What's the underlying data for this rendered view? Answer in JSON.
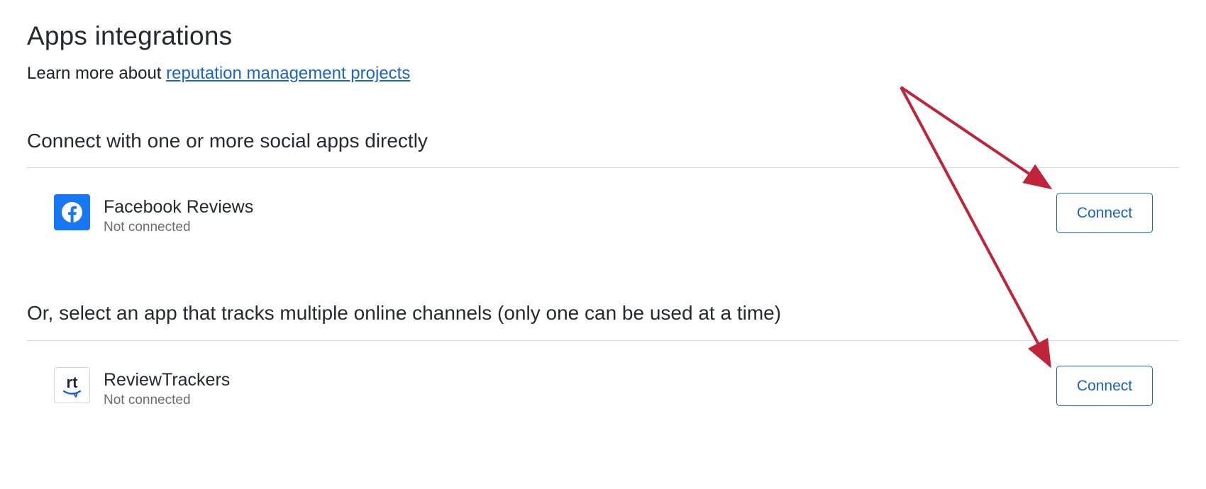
{
  "page": {
    "title": "Apps integrations",
    "intro_text": "Learn more about ",
    "intro_link": "reputation management projects"
  },
  "sections": [
    {
      "heading": "Connect with one or more social apps directly",
      "apps": [
        {
          "name": "Facebook Reviews",
          "status": "Not connected",
          "icon": "facebook-icon",
          "icon_color": "#1877f2",
          "button_label": "Connect"
        }
      ]
    },
    {
      "heading": "Or, select an app that tracks multiple online channels (only one can be used at a time)",
      "apps": [
        {
          "name": "ReviewTrackers",
          "status": "Not connected",
          "icon": "reviewtrackers-icon",
          "icon_text": "rt",
          "button_label": "Connect"
        }
      ]
    }
  ],
  "colors": {
    "accent": "#1a64c8",
    "annotation_arrow": "#c0243a",
    "divider": "#dcdde0"
  }
}
